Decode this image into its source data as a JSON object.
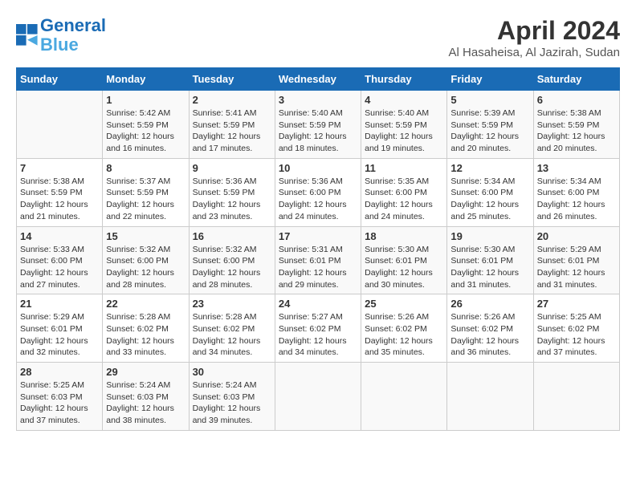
{
  "header": {
    "logo_line1": "General",
    "logo_line2": "Blue",
    "title": "April 2024",
    "subtitle": "Al Hasaheisa, Al Jazirah, Sudan"
  },
  "columns": [
    "Sunday",
    "Monday",
    "Tuesday",
    "Wednesday",
    "Thursday",
    "Friday",
    "Saturday"
  ],
  "weeks": [
    [
      {
        "day": "",
        "content": ""
      },
      {
        "day": "1",
        "content": "Sunrise: 5:42 AM\nSunset: 5:59 PM\nDaylight: 12 hours\nand 16 minutes."
      },
      {
        "day": "2",
        "content": "Sunrise: 5:41 AM\nSunset: 5:59 PM\nDaylight: 12 hours\nand 17 minutes."
      },
      {
        "day": "3",
        "content": "Sunrise: 5:40 AM\nSunset: 5:59 PM\nDaylight: 12 hours\nand 18 minutes."
      },
      {
        "day": "4",
        "content": "Sunrise: 5:40 AM\nSunset: 5:59 PM\nDaylight: 12 hours\nand 19 minutes."
      },
      {
        "day": "5",
        "content": "Sunrise: 5:39 AM\nSunset: 5:59 PM\nDaylight: 12 hours\nand 20 minutes."
      },
      {
        "day": "6",
        "content": "Sunrise: 5:38 AM\nSunset: 5:59 PM\nDaylight: 12 hours\nand 20 minutes."
      }
    ],
    [
      {
        "day": "7",
        "content": "Sunrise: 5:38 AM\nSunset: 5:59 PM\nDaylight: 12 hours\nand 21 minutes."
      },
      {
        "day": "8",
        "content": "Sunrise: 5:37 AM\nSunset: 5:59 PM\nDaylight: 12 hours\nand 22 minutes."
      },
      {
        "day": "9",
        "content": "Sunrise: 5:36 AM\nSunset: 5:59 PM\nDaylight: 12 hours\nand 23 minutes."
      },
      {
        "day": "10",
        "content": "Sunrise: 5:36 AM\nSunset: 6:00 PM\nDaylight: 12 hours\nand 24 minutes."
      },
      {
        "day": "11",
        "content": "Sunrise: 5:35 AM\nSunset: 6:00 PM\nDaylight: 12 hours\nand 24 minutes."
      },
      {
        "day": "12",
        "content": "Sunrise: 5:34 AM\nSunset: 6:00 PM\nDaylight: 12 hours\nand 25 minutes."
      },
      {
        "day": "13",
        "content": "Sunrise: 5:34 AM\nSunset: 6:00 PM\nDaylight: 12 hours\nand 26 minutes."
      }
    ],
    [
      {
        "day": "14",
        "content": "Sunrise: 5:33 AM\nSunset: 6:00 PM\nDaylight: 12 hours\nand 27 minutes."
      },
      {
        "day": "15",
        "content": "Sunrise: 5:32 AM\nSunset: 6:00 PM\nDaylight: 12 hours\nand 28 minutes."
      },
      {
        "day": "16",
        "content": "Sunrise: 5:32 AM\nSunset: 6:00 PM\nDaylight: 12 hours\nand 28 minutes."
      },
      {
        "day": "17",
        "content": "Sunrise: 5:31 AM\nSunset: 6:01 PM\nDaylight: 12 hours\nand 29 minutes."
      },
      {
        "day": "18",
        "content": "Sunrise: 5:30 AM\nSunset: 6:01 PM\nDaylight: 12 hours\nand 30 minutes."
      },
      {
        "day": "19",
        "content": "Sunrise: 5:30 AM\nSunset: 6:01 PM\nDaylight: 12 hours\nand 31 minutes."
      },
      {
        "day": "20",
        "content": "Sunrise: 5:29 AM\nSunset: 6:01 PM\nDaylight: 12 hours\nand 31 minutes."
      }
    ],
    [
      {
        "day": "21",
        "content": "Sunrise: 5:29 AM\nSunset: 6:01 PM\nDaylight: 12 hours\nand 32 minutes."
      },
      {
        "day": "22",
        "content": "Sunrise: 5:28 AM\nSunset: 6:02 PM\nDaylight: 12 hours\nand 33 minutes."
      },
      {
        "day": "23",
        "content": "Sunrise: 5:28 AM\nSunset: 6:02 PM\nDaylight: 12 hours\nand 34 minutes."
      },
      {
        "day": "24",
        "content": "Sunrise: 5:27 AM\nSunset: 6:02 PM\nDaylight: 12 hours\nand 34 minutes."
      },
      {
        "day": "25",
        "content": "Sunrise: 5:26 AM\nSunset: 6:02 PM\nDaylight: 12 hours\nand 35 minutes."
      },
      {
        "day": "26",
        "content": "Sunrise: 5:26 AM\nSunset: 6:02 PM\nDaylight: 12 hours\nand 36 minutes."
      },
      {
        "day": "27",
        "content": "Sunrise: 5:25 AM\nSunset: 6:02 PM\nDaylight: 12 hours\nand 37 minutes."
      }
    ],
    [
      {
        "day": "28",
        "content": "Sunrise: 5:25 AM\nSunset: 6:03 PM\nDaylight: 12 hours\nand 37 minutes."
      },
      {
        "day": "29",
        "content": "Sunrise: 5:24 AM\nSunset: 6:03 PM\nDaylight: 12 hours\nand 38 minutes."
      },
      {
        "day": "30",
        "content": "Sunrise: 5:24 AM\nSunset: 6:03 PM\nDaylight: 12 hours\nand 39 minutes."
      },
      {
        "day": "",
        "content": ""
      },
      {
        "day": "",
        "content": ""
      },
      {
        "day": "",
        "content": ""
      },
      {
        "day": "",
        "content": ""
      }
    ]
  ]
}
